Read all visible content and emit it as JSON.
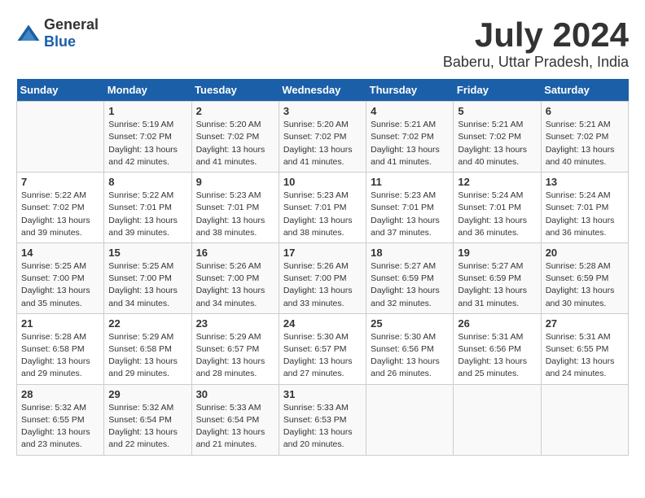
{
  "logo": {
    "general": "General",
    "blue": "Blue"
  },
  "title": "July 2024",
  "location": "Baberu, Uttar Pradesh, India",
  "headers": [
    "Sunday",
    "Monday",
    "Tuesday",
    "Wednesday",
    "Thursday",
    "Friday",
    "Saturday"
  ],
  "weeks": [
    [
      {
        "day": "",
        "content": ""
      },
      {
        "day": "1",
        "content": "Sunrise: 5:19 AM\nSunset: 7:02 PM\nDaylight: 13 hours\nand 42 minutes."
      },
      {
        "day": "2",
        "content": "Sunrise: 5:20 AM\nSunset: 7:02 PM\nDaylight: 13 hours\nand 41 minutes."
      },
      {
        "day": "3",
        "content": "Sunrise: 5:20 AM\nSunset: 7:02 PM\nDaylight: 13 hours\nand 41 minutes."
      },
      {
        "day": "4",
        "content": "Sunrise: 5:21 AM\nSunset: 7:02 PM\nDaylight: 13 hours\nand 41 minutes."
      },
      {
        "day": "5",
        "content": "Sunrise: 5:21 AM\nSunset: 7:02 PM\nDaylight: 13 hours\nand 40 minutes."
      },
      {
        "day": "6",
        "content": "Sunrise: 5:21 AM\nSunset: 7:02 PM\nDaylight: 13 hours\nand 40 minutes."
      }
    ],
    [
      {
        "day": "7",
        "content": "Sunrise: 5:22 AM\nSunset: 7:02 PM\nDaylight: 13 hours\nand 39 minutes."
      },
      {
        "day": "8",
        "content": "Sunrise: 5:22 AM\nSunset: 7:01 PM\nDaylight: 13 hours\nand 39 minutes."
      },
      {
        "day": "9",
        "content": "Sunrise: 5:23 AM\nSunset: 7:01 PM\nDaylight: 13 hours\nand 38 minutes."
      },
      {
        "day": "10",
        "content": "Sunrise: 5:23 AM\nSunset: 7:01 PM\nDaylight: 13 hours\nand 38 minutes."
      },
      {
        "day": "11",
        "content": "Sunrise: 5:23 AM\nSunset: 7:01 PM\nDaylight: 13 hours\nand 37 minutes."
      },
      {
        "day": "12",
        "content": "Sunrise: 5:24 AM\nSunset: 7:01 PM\nDaylight: 13 hours\nand 36 minutes."
      },
      {
        "day": "13",
        "content": "Sunrise: 5:24 AM\nSunset: 7:01 PM\nDaylight: 13 hours\nand 36 minutes."
      }
    ],
    [
      {
        "day": "14",
        "content": "Sunrise: 5:25 AM\nSunset: 7:00 PM\nDaylight: 13 hours\nand 35 minutes."
      },
      {
        "day": "15",
        "content": "Sunrise: 5:25 AM\nSunset: 7:00 PM\nDaylight: 13 hours\nand 34 minutes."
      },
      {
        "day": "16",
        "content": "Sunrise: 5:26 AM\nSunset: 7:00 PM\nDaylight: 13 hours\nand 34 minutes."
      },
      {
        "day": "17",
        "content": "Sunrise: 5:26 AM\nSunset: 7:00 PM\nDaylight: 13 hours\nand 33 minutes."
      },
      {
        "day": "18",
        "content": "Sunrise: 5:27 AM\nSunset: 6:59 PM\nDaylight: 13 hours\nand 32 minutes."
      },
      {
        "day": "19",
        "content": "Sunrise: 5:27 AM\nSunset: 6:59 PM\nDaylight: 13 hours\nand 31 minutes."
      },
      {
        "day": "20",
        "content": "Sunrise: 5:28 AM\nSunset: 6:59 PM\nDaylight: 13 hours\nand 30 minutes."
      }
    ],
    [
      {
        "day": "21",
        "content": "Sunrise: 5:28 AM\nSunset: 6:58 PM\nDaylight: 13 hours\nand 29 minutes."
      },
      {
        "day": "22",
        "content": "Sunrise: 5:29 AM\nSunset: 6:58 PM\nDaylight: 13 hours\nand 29 minutes."
      },
      {
        "day": "23",
        "content": "Sunrise: 5:29 AM\nSunset: 6:57 PM\nDaylight: 13 hours\nand 28 minutes."
      },
      {
        "day": "24",
        "content": "Sunrise: 5:30 AM\nSunset: 6:57 PM\nDaylight: 13 hours\nand 27 minutes."
      },
      {
        "day": "25",
        "content": "Sunrise: 5:30 AM\nSunset: 6:56 PM\nDaylight: 13 hours\nand 26 minutes."
      },
      {
        "day": "26",
        "content": "Sunrise: 5:31 AM\nSunset: 6:56 PM\nDaylight: 13 hours\nand 25 minutes."
      },
      {
        "day": "27",
        "content": "Sunrise: 5:31 AM\nSunset: 6:55 PM\nDaylight: 13 hours\nand 24 minutes."
      }
    ],
    [
      {
        "day": "28",
        "content": "Sunrise: 5:32 AM\nSunset: 6:55 PM\nDaylight: 13 hours\nand 23 minutes."
      },
      {
        "day": "29",
        "content": "Sunrise: 5:32 AM\nSunset: 6:54 PM\nDaylight: 13 hours\nand 22 minutes."
      },
      {
        "day": "30",
        "content": "Sunrise: 5:33 AM\nSunset: 6:54 PM\nDaylight: 13 hours\nand 21 minutes."
      },
      {
        "day": "31",
        "content": "Sunrise: 5:33 AM\nSunset: 6:53 PM\nDaylight: 13 hours\nand 20 minutes."
      },
      {
        "day": "",
        "content": ""
      },
      {
        "day": "",
        "content": ""
      },
      {
        "day": "",
        "content": ""
      }
    ]
  ]
}
